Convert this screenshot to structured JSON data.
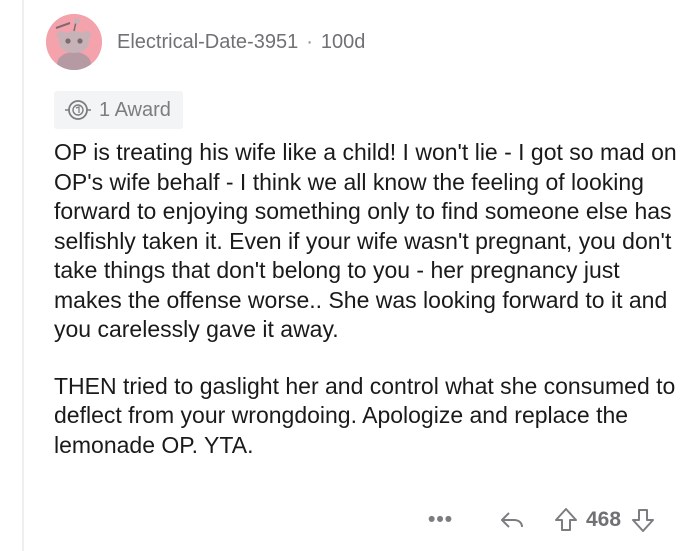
{
  "comment": {
    "username": "Electrical-Date-3951",
    "separator": "·",
    "age": "100d",
    "award_label": "1 Award",
    "paragraphs": [
      "OP is treating his wife like a child! I won't lie - I got so mad on OP's wife behalf - I think we all know the feeling of looking forward to enjoying something only to find someone else has selfishly taken it. Even if your wife wasn't pregnant, you don't take things that don't belong to you - her pregnancy just makes the offense worse.. She was looking forward to it and you carelessly gave it away.",
      "THEN tried to gaslight her and control what she consumed to deflect from your wrongdoing. Apologize and replace the lemonade OP. YTA."
    ],
    "more_label": "•••",
    "score": "468"
  },
  "colors": {
    "avatar_bg": "#f4a3ad",
    "meta_text": "#6f7173",
    "body_text": "#1a1a1b",
    "award_bg": "#f3f4f5"
  },
  "icons": {
    "avatar": "snoo-avatar-icon",
    "award": "award-medal-icon",
    "reply": "reply-arrow-icon",
    "upvote": "upvote-arrow-icon",
    "downvote": "downvote-arrow-icon"
  }
}
